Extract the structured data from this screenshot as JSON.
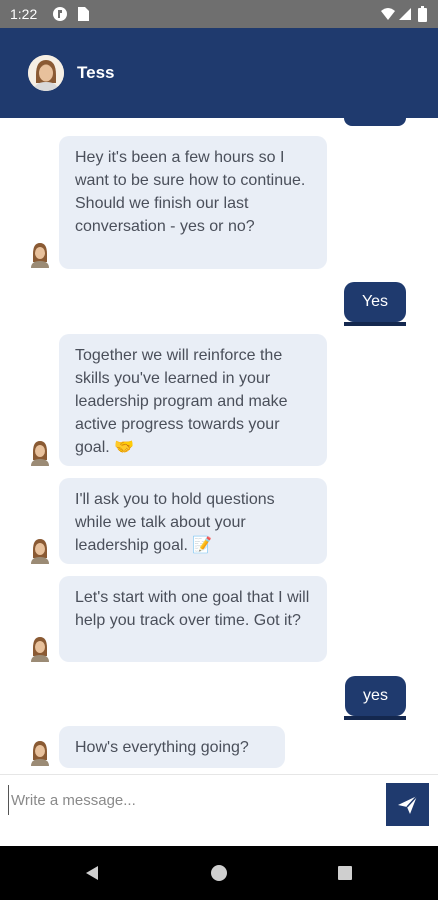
{
  "status_bar": {
    "time": "1:22"
  },
  "header": {
    "contact_name": "Tess"
  },
  "messages": [
    {
      "from": "bot",
      "text": "Hey it's been a few hours so I want to be sure how to continue. Should we finish our last conversation - yes or no?"
    },
    {
      "from": "user",
      "text": "Yes"
    },
    {
      "from": "bot",
      "text": "Together we will reinforce the skills you've learned in your leadership program and make active progress towards your goal. 🤝"
    },
    {
      "from": "bot",
      "text": "I'll ask you to hold questions while we talk about your leadership goal. 📝"
    },
    {
      "from": "bot",
      "text": "Let's start with one goal that I will help you track over time. Got it?"
    },
    {
      "from": "user",
      "text": "yes"
    },
    {
      "from": "bot",
      "text": "How's everything going?"
    }
  ],
  "composer": {
    "placeholder": "Write a message..."
  },
  "colors": {
    "header": "#1f3a6e",
    "bot_bubble": "#e9eef6",
    "user_bubble": "#1f3a6e"
  },
  "icons": [
    "notification-icon",
    "sim-card-icon",
    "wifi-icon",
    "signal-icon",
    "battery-icon",
    "send-icon",
    "back-icon",
    "home-icon",
    "recents-icon"
  ]
}
